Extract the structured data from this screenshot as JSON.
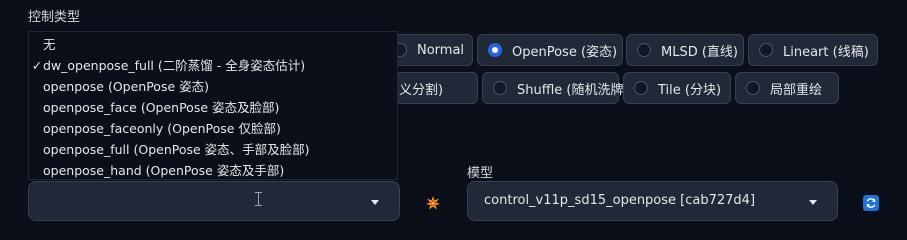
{
  "section": {
    "title": "控制类型"
  },
  "radios": [
    {
      "label": "Normal",
      "checked": false
    },
    {
      "label": "OpenPose (姿态)",
      "checked": true
    },
    {
      "label": "MLSD (直线)",
      "checked": false
    },
    {
      "label": "Lineart (线稿)",
      "checked": false
    },
    {
      "label": "义分割)",
      "checked": false
    },
    {
      "label": "Shuffle (随机洗牌)",
      "checked": false
    },
    {
      "label": "Tile (分块)",
      "checked": false
    },
    {
      "label": "局部重绘",
      "checked": false
    }
  ],
  "preprocessor_menu": {
    "selected_mark": "✓",
    "items": [
      {
        "label": "无"
      },
      {
        "label": "dw_openpose_full (二阶蒸馏 - 全身姿态估计)",
        "selected": true
      },
      {
        "label": "openpose (OpenPose 姿态)"
      },
      {
        "label": "openpose_face (OpenPose 姿态及脸部)"
      },
      {
        "label": "openpose_faceonly (OpenPose 仅脸部)"
      },
      {
        "label": "openpose_full (OpenPose 姿态、手部及脸部)"
      },
      {
        "label": "openpose_hand (OpenPose 姿态及手部)"
      }
    ]
  },
  "preprocessor_select": {
    "value": ""
  },
  "model": {
    "label": "模型",
    "value": "control_v11p_sd15_openpose [cab727d4]"
  },
  "icons": {
    "run": "explosion-icon",
    "refresh": "refresh-icon",
    "accent": "#2563eb"
  }
}
